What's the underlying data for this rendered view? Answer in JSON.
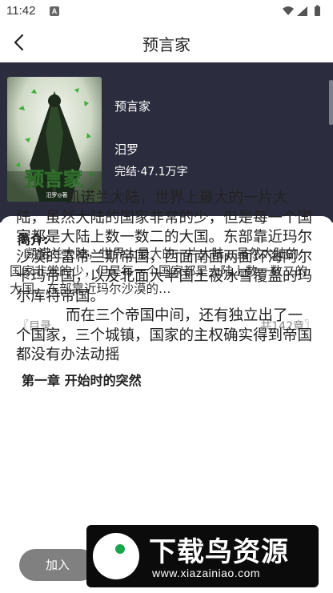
{
  "status_bar": {
    "time": "11:42",
    "notification_icon": "A"
  },
  "app_bar": {
    "title": "预言家",
    "back_icon": "chevron-left-icon"
  },
  "book": {
    "name": "预言家",
    "author": "汨罗",
    "meta": "完结·47.1万字",
    "cover_text": "预言家",
    "cover_author": "汨罗◎著"
  },
  "intro": {
    "label": "简介:",
    "text": "凯诺兰大陆，世界上最大的一片大陆，虽然大陆的国家非常的少，但是每一个国家都是大陆上数一数二的大国。东部靠近玛尔沙漠的…"
  },
  "toc": {
    "label": "〖目录",
    "count": "共142章〗"
  },
  "chapter": {
    "title": "第一章 开始时的突然",
    "paragraphs": [
      "凯诺兰大陆，世界上最大的一片大陆，虽然大陆的国家非常的少，但是每一个国家都是大陆上数一数二的大国。东部靠近玛尔沙漠的雷帝兰斯帝国，西面南面两面环海阿尔卡玛帝国，以及北面大半国土被冰雪覆盖的玛尔库特帝国。",
      "而在三个帝国中间，还有独立出了一个国家，三个城镇，国家的主权确实得到帝国都没有办法动摇"
    ]
  },
  "actions": {
    "add_to_shelf": "加入"
  },
  "watermark": {
    "name": "下载鸟资源",
    "url": "www.xiazainiao.com"
  },
  "colors": {
    "hero_bg": "#2b2d3f",
    "sheet_bg": "#ffffff",
    "muted_text": "#888888"
  }
}
